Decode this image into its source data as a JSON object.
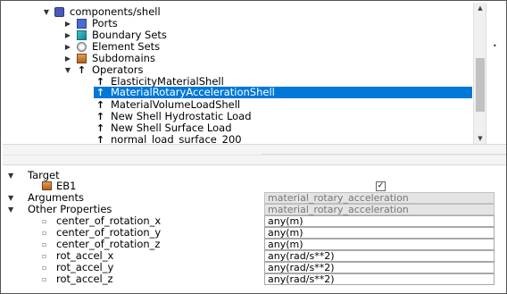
{
  "tree": {
    "root": {
      "label": "components/shell",
      "icon": "component-cube-icon"
    },
    "children": [
      {
        "label": "Ports",
        "icon": "ports-cube-icon"
      },
      {
        "label": "Boundary Sets",
        "icon": "boundary-sets-icon"
      },
      {
        "label": "Element Sets",
        "icon": "element-sets-icon"
      },
      {
        "label": "Subdomains",
        "icon": "subdomains-icon"
      },
      {
        "label": "Operators",
        "icon": "operator-arrow-icon"
      }
    ],
    "operators": [
      {
        "label": "ElasticityMaterialShell",
        "selected": false
      },
      {
        "label": "MaterialRotaryAccelerationShell",
        "selected": true
      },
      {
        "label": "MaterialVolumeLoadShell",
        "selected": false
      },
      {
        "label": "New Shell Hydrostatic Load",
        "selected": false
      },
      {
        "label": "New Shell Surface Load",
        "selected": false
      },
      {
        "label": "normal_load_surface_200",
        "selected": false
      }
    ],
    "operator_glyph": "↑",
    "expand_glyph": "▼",
    "collapsed_glyph": "▶",
    "scroll_up": "▲",
    "scroll_down": "▼",
    "side_dot": "•"
  },
  "properties": {
    "target": {
      "label": "Target",
      "items": [
        {
          "label": "EB1",
          "checked": true,
          "check_glyph": "✓"
        }
      ]
    },
    "arguments": {
      "label": "Arguments",
      "value": "material_rotary_acceleration"
    },
    "other": {
      "label": "Other Properties",
      "value": "material_rotary_acceleration",
      "items": [
        {
          "label": "center_of_rotation_x",
          "value": "any(m)"
        },
        {
          "label": "center_of_rotation_y",
          "value": "any(m)"
        },
        {
          "label": "center_of_rotation_z",
          "value": "any(m)"
        },
        {
          "label": "rot_accel_x",
          "value": "any(rad/s**2)"
        },
        {
          "label": "rot_accel_y",
          "value": "any(rad/s**2)"
        },
        {
          "label": "rot_accel_z",
          "value": "any(rad/s**2)"
        }
      ]
    },
    "bullet_glyph": "▫",
    "expand_glyph": "▼"
  },
  "colors": {
    "selection": "#0078d7",
    "readonly_field": "#e4e4e4"
  }
}
